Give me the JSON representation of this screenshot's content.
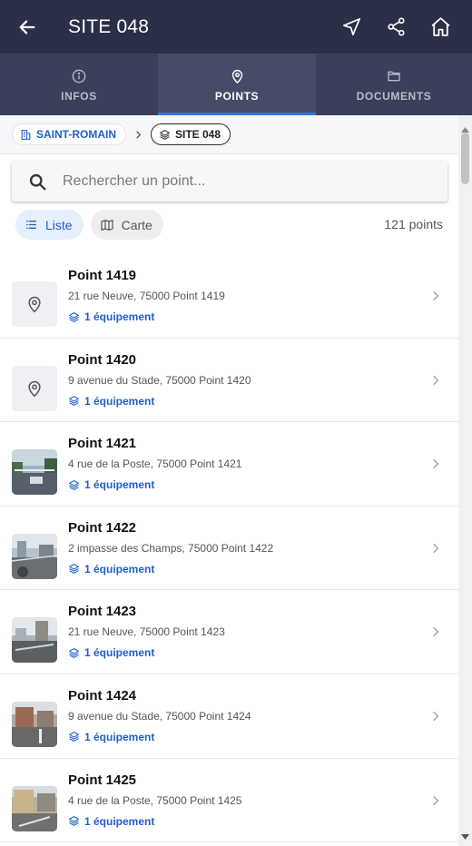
{
  "appbar": {
    "title": "SITE 048",
    "back_icon": "arrow-left-icon",
    "actions": [
      "navigation-arrow-icon",
      "share-icon",
      "home-icon"
    ]
  },
  "tabs": [
    {
      "label": "INFOS",
      "icon": "info-icon",
      "active": false
    },
    {
      "label": "POINTS",
      "icon": "map-pin-icon",
      "active": true
    },
    {
      "label": "DOCUMENTS",
      "icon": "folder-icon",
      "active": false
    }
  ],
  "breadcrumb": {
    "parent": "SAINT-ROMAIN",
    "current": "SITE 048"
  },
  "search": {
    "placeholder": "Rechercher un point..."
  },
  "view": {
    "list_label": "Liste",
    "map_label": "Carte",
    "selected": "Liste"
  },
  "count_label": "121 points",
  "points": [
    {
      "name": "Point 1419",
      "address": "21 rue Neuve, 75000 Point 1419",
      "equipment": "1 équipement",
      "photo": false
    },
    {
      "name": "Point 1420",
      "address": "9 avenue du Stade, 75000 Point 1420",
      "equipment": "1 équipement",
      "photo": false
    },
    {
      "name": "Point 1421",
      "address": "4 rue de la Poste, 75000 Point 1421",
      "equipment": "1 équipement",
      "photo": true
    },
    {
      "name": "Point 1422",
      "address": "2 impasse des Champs, 75000 Point 1422",
      "equipment": "1 équipement",
      "photo": true
    },
    {
      "name": "Point 1423",
      "address": "21 rue Neuve, 75000 Point 1423",
      "equipment": "1 équipement",
      "photo": true
    },
    {
      "name": "Point 1424",
      "address": "9 avenue du Stade, 75000 Point 1424",
      "equipment": "1 équipement",
      "photo": true
    },
    {
      "name": "Point 1425",
      "address": "4 rue de la Poste, 75000 Point 1425",
      "equipment": "1 équipement",
      "photo": true
    }
  ],
  "colors": {
    "appbar": "#2b3048",
    "tabbar": "#3a405a",
    "accent": "#1f5fcc",
    "tab_indicator": "#3b74d6"
  }
}
